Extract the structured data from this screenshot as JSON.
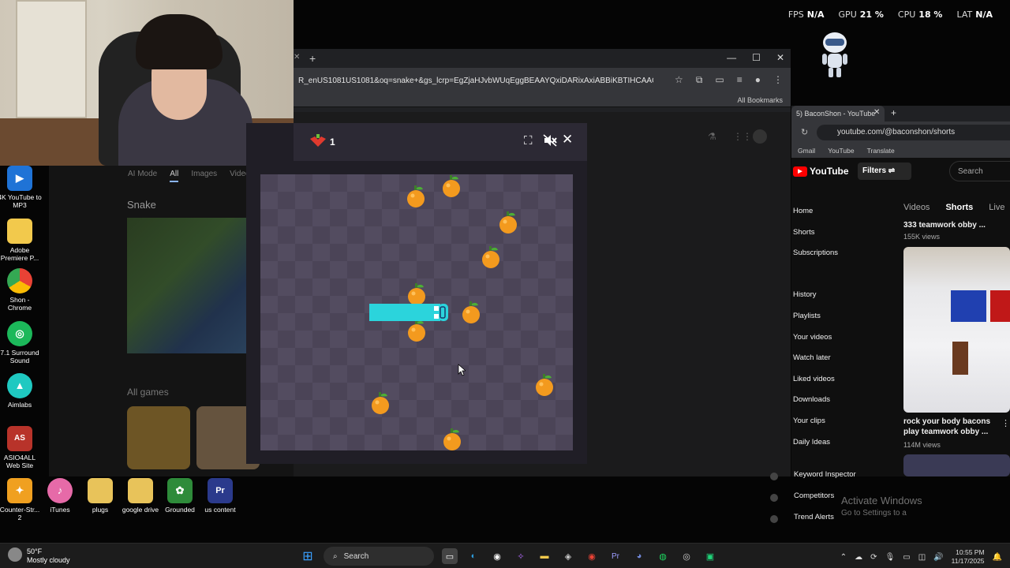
{
  "hud": {
    "fps_label": "FPS",
    "fps_value": "N/A",
    "gpu_label": "GPU",
    "gpu_value": "21 %",
    "cpu_label": "CPU",
    "cpu_value": "18 %",
    "lat_label": "LAT",
    "lat_value": "N/A"
  },
  "desktop_icons": [
    {
      "label": "4K YouTube to MP3",
      "color": "#1f73d6",
      "glyph": "▶"
    },
    {
      "label": "Adobe Premiere P...",
      "color": "#f2c94c",
      "glyph": "▬"
    },
    {
      "label": "Shon - Chrome",
      "color": "#e94235",
      "glyph": "◉"
    },
    {
      "label": "7.1 Surround Sound",
      "color": "#2bd36b",
      "glyph": "◎"
    },
    {
      "label": "Aimlabs",
      "color": "#1fc9c1",
      "glyph": "▲"
    },
    {
      "label": "ASIO4ALL Web Site",
      "color": "#c93b2b",
      "glyph": "AS"
    },
    {
      "label": "Counter-Str... 2",
      "color": "#f0a020",
      "glyph": "✦"
    },
    {
      "label": "iTunes",
      "color": "#e66aa8",
      "glyph": "♪"
    },
    {
      "label": "plugs",
      "color": "#e8c35a",
      "glyph": "▬"
    },
    {
      "label": "google drive",
      "color": "#e8c35a",
      "glyph": "▬"
    },
    {
      "label": "Grounded",
      "color": "#2e8b3a",
      "glyph": "✿"
    },
    {
      "label": "us content",
      "color": "#2b3a8c",
      "glyph": "Pr"
    }
  ],
  "chrome": {
    "url": "R_enUS1081US1081&oq=snake+&gs_lcrp=EgZjaHJvbWUqEggBEAAYQxiDARixAxiABBiKBTIHCAAQABiPAjIS...",
    "bookmarks": "All Bookmarks",
    "win_min": "—",
    "win_max": "☐",
    "win_close": "✕"
  },
  "google": {
    "tabs": [
      "AI Mode",
      "All",
      "Images",
      "Videos"
    ],
    "result_title": "Snake",
    "all_games": "All games"
  },
  "game": {
    "score": "1",
    "fullscreen_icon": "⛶",
    "mute_icon": "🔇",
    "close_icon": "✕"
  },
  "youtube": {
    "tab_title": "5) BaconShon - YouTube",
    "url": "youtube.com/@baconshon/shorts",
    "bookmarks": [
      "Gmail",
      "YouTube",
      "Translate"
    ],
    "logo": "YouTube",
    "filters": "Filters",
    "search_placeholder": "Search",
    "nav_tabs": [
      "Videos",
      "Shorts",
      "Live"
    ],
    "sidebar": [
      "Home",
      "Shorts",
      "Subscriptions",
      "",
      "History",
      "Playlists",
      "Your videos",
      "Watch later",
      "Liked videos",
      "Downloads",
      "Your clips",
      "Daily Ideas"
    ],
    "ext_items": [
      "Keyword Inspector",
      "Competitors",
      "Trend Alerts"
    ],
    "videos": [
      {
        "title": "333 teamwork obby ...",
        "views": "155K views"
      },
      {
        "title": "rock your body bacons play teamwork obby ...",
        "views": "114M views"
      }
    ]
  },
  "watermark": {
    "title": "Activate Windows",
    "sub": "Go to Settings to a"
  },
  "taskbar": {
    "weather_temp": "50°F",
    "weather_desc": "Mostly cloudy",
    "search_label": "Search",
    "time": "10:55 PM",
    "date": "11/17/2025"
  }
}
